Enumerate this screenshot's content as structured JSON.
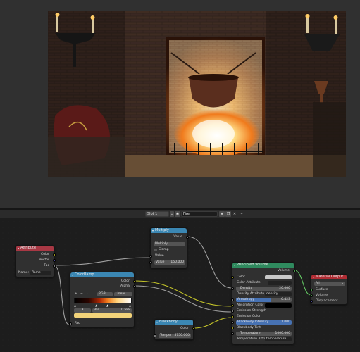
{
  "header": {
    "slot": "Slot 1",
    "material_name": "Fire"
  },
  "nodes": {
    "attribute": {
      "title": "Attribute",
      "outputs": [
        "Color",
        "Vector",
        "Fac"
      ],
      "name_label": "Name:",
      "name_value": "flame"
    },
    "colorramp": {
      "title": "ColorRamp",
      "outputs": [
        "Color",
        "Alpha"
      ],
      "mode": "RGB",
      "interpolation": "Linear",
      "stop_index": "3",
      "pos_label": "Pos",
      "pos_value": "0.588",
      "input": "Fac"
    },
    "multiply": {
      "title": "Multiply",
      "output": "Value",
      "operation": "Multiply",
      "clamp_label": "Clamp",
      "input1": "Value",
      "input2_label": "Value",
      "input2_value": "150.000"
    },
    "blackbody": {
      "title": "Blackbody",
      "output": "Color",
      "temp_label": "Temper",
      "temp_value": "5750.000"
    },
    "principled": {
      "title": "Principled Volume",
      "output": "Volume",
      "rows": {
        "color": "Color",
        "color_attr": "Color Attribute",
        "density_label": "Density",
        "density_value": "20.000",
        "density_attr_label": "Density Attribute",
        "density_attr_value": "density",
        "anisotropy_label": "Anisotropy",
        "anisotropy_value": "0.423",
        "absorption": "Absorption Color",
        "emission_strength": "Emission Strength",
        "emission_color": "Emission Color",
        "blackbody_int_label": "Blackbody Intensity",
        "blackbody_int_value": "1.000",
        "blackbody_tint": "Blackbody Tint",
        "temperature_label": "Temperature",
        "temperature_value": "1000.000",
        "temp_attr_label": "Temperature Attri...",
        "temp_attr_value": "temperature"
      }
    },
    "output": {
      "title": "Material Output",
      "target": "All",
      "inputs": [
        "Surface",
        "Volume",
        "Displacement"
      ]
    }
  },
  "colors": {
    "attribute_header": "#a83844",
    "converter_header": "#3b87b3",
    "shader_header": "#2f8a5e",
    "output_header": "#b02c33",
    "socket_color": "#c7c729",
    "socket_float": "#a1a1a1",
    "socket_vector": "#6363c7",
    "socket_shader": "#63c763"
  }
}
